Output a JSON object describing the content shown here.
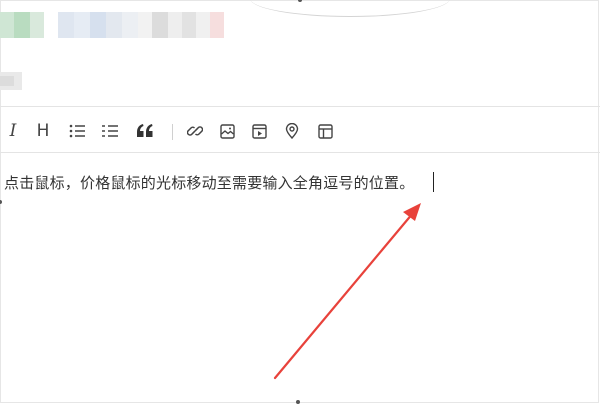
{
  "editor": {
    "content_text": "点击鼠标，价格鼠标的光标移动至需要输入全角逗号的位置。"
  },
  "toolbar": {
    "buttons": [
      {
        "name": "italic",
        "label": "I"
      },
      {
        "name": "heading",
        "label": "H"
      },
      {
        "name": "ordered-list",
        "label": ""
      },
      {
        "name": "bullet-list",
        "label": ""
      },
      {
        "name": "quote",
        "label": ""
      },
      {
        "name": "link",
        "label": ""
      },
      {
        "name": "image",
        "label": ""
      },
      {
        "name": "video",
        "label": ""
      },
      {
        "name": "location",
        "label": ""
      },
      {
        "name": "template",
        "label": ""
      }
    ]
  },
  "annotation": {
    "arrow_color": "#e8423b"
  },
  "colors": {
    "text": "#333333",
    "icon": "#444444",
    "divider": "#e4e4e4"
  }
}
